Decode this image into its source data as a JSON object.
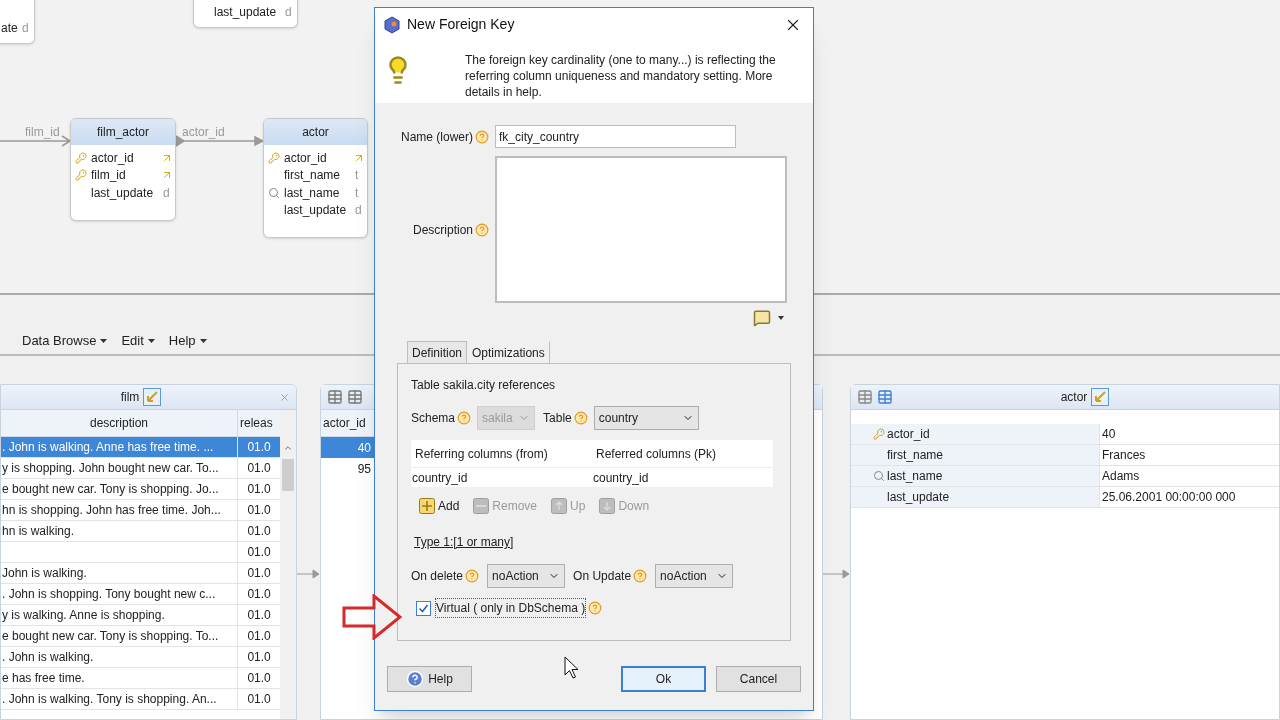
{
  "diagram": {
    "entities": [
      {
        "columns": [
          {
            "name": "ate",
            "kind": "plain",
            "type": "d"
          }
        ]
      },
      {
        "columns": [
          {
            "name": "last_update",
            "kind": "plain",
            "type": "d"
          }
        ]
      },
      {
        "title": "film_actor",
        "columns": [
          {
            "name": "actor_id",
            "kind": "key"
          },
          {
            "name": "film_id",
            "kind": "key"
          },
          {
            "name": "last_update",
            "kind": "plain",
            "type": "d"
          }
        ]
      },
      {
        "title": "actor",
        "columns": [
          {
            "name": "actor_id",
            "kind": "key"
          },
          {
            "name": "first_name",
            "kind": "plain",
            "type": "t"
          },
          {
            "name": "last_name",
            "kind": "index",
            "type": "t"
          },
          {
            "name": "last_update",
            "kind": "plain",
            "type": "d"
          }
        ]
      }
    ],
    "connectors": [
      {
        "label": "film_id"
      },
      {
        "label": "actor_id"
      }
    ]
  },
  "menu": [
    "Data Browse",
    "Edit",
    "Help"
  ],
  "film_panel": {
    "title": "film",
    "columns": [
      "description",
      "releas"
    ],
    "rows": [
      {
        "description": ". John is walking. Anne has free time. ...",
        "release": "01.0",
        "selected": true
      },
      {
        "description": "y is shopping. John bought new car. To...",
        "release": "01.0",
        "selected": false
      },
      {
        "description": "e bought new car. Tony is shopping. Jo...",
        "release": "01.0",
        "selected": false
      },
      {
        "description": "hn is shopping. John has free time. Joh...",
        "release": "01.0",
        "selected": false
      },
      {
        "description": "hn is walking.",
        "release": "01.0",
        "selected": false
      },
      {
        "release": "01.0",
        "selected": false
      },
      {
        "description": "John is walking.",
        "release": "01.0",
        "selected": false
      },
      {
        "description": ". John is shopping. Tony bought new c...",
        "release": "01.0",
        "selected": false
      },
      {
        "description": "y is walking. Anne is shopping.",
        "release": "01.0",
        "selected": false
      },
      {
        "description": "e bought new car. Tony is shopping. To...",
        "release": "01.0",
        "selected": false
      },
      {
        "description": ". John is walking.",
        "release": "01.0",
        "selected": false
      },
      {
        "description": "e has free time.",
        "release": "01.0",
        "selected": false
      },
      {
        "description": ". John is walking. Tony is shopping. An...",
        "release": "01.0",
        "selected": false
      }
    ]
  },
  "film_actor_panel": {
    "column": "actor_id",
    "rows": [
      {
        "value": "40",
        "selected": true
      },
      {
        "value": "95",
        "selected": false
      }
    ]
  },
  "actor_panel": {
    "title": "actor",
    "rows": [
      {
        "field": "actor_id",
        "kind": "key",
        "value": "40"
      },
      {
        "field": "first_name",
        "kind": "plain",
        "value": "Frances"
      },
      {
        "field": "last_name",
        "kind": "index",
        "value": "Adams"
      },
      {
        "field": "last_update",
        "kind": "plain",
        "value": "25.06.2001 00:00:00 000"
      }
    ]
  },
  "dialog": {
    "title": "New Foreign Key",
    "info": "The foreign key cardinality (one to many...) is reflecting the referring column uniqueness and mandatory setting. More details in help.",
    "name_label": "Name (lower)",
    "name_value": "fk_city_country",
    "description_label": "Description",
    "tabs": [
      {
        "label": "Definition",
        "selected": true
      },
      {
        "label": "Optimizations",
        "selected": false
      }
    ],
    "references": "Table sakila.city references",
    "target": [
      {
        "label": "Schema",
        "value": "sakila",
        "disabled": true
      },
      {
        "label": "Table",
        "value": "country",
        "disabled": false
      }
    ],
    "columns_table": {
      "headers": [
        "Referring columns (from)",
        "Referred columns (Pk)"
      ],
      "rows": [
        [
          "country_id",
          "country_id"
        ]
      ]
    },
    "actions": [
      {
        "label": "Add",
        "kind": "add",
        "disabled": false
      },
      {
        "label": "Remove",
        "kind": "remove",
        "disabled": true
      },
      {
        "label": "Up",
        "kind": "up",
        "disabled": true
      },
      {
        "label": "Down",
        "kind": "down",
        "disabled": true
      }
    ],
    "type_link": "Type 1:[1 or many]",
    "rules": [
      {
        "label": "On delete",
        "value": "noAction"
      },
      {
        "label": "On Update",
        "value": "noAction"
      }
    ],
    "virtual": {
      "label": "Virtual ( only in DbSchema )",
      "checked": true
    },
    "buttons": [
      {
        "label": "Help",
        "kind": "help"
      },
      {
        "label": "Ok",
        "kind": "default"
      },
      {
        "label": "Cancel",
        "kind": "plain"
      }
    ]
  }
}
